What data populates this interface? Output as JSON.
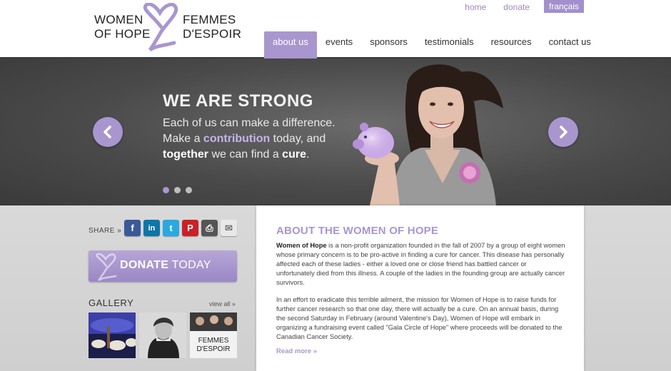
{
  "logo": {
    "line1_en": "WOMEN",
    "line2_en": "OF HOPE",
    "line1_fr": "FEMMES",
    "line2_fr": "D'ESPOIR"
  },
  "top_links": [
    "home",
    "donate"
  ],
  "lang_button": "français",
  "nav": [
    "about us",
    "events",
    "sponsors",
    "testimonials",
    "resources",
    "contact us"
  ],
  "hero": {
    "title": "WE ARE STRONG",
    "line1": "Each of us can make a difference.",
    "line2_pre": "Make a ",
    "line2_hl": "contribution",
    "line2_post": " today, and",
    "line3_b1": "together",
    "line3_mid": " we can find a ",
    "line3_b2": "cure",
    "line3_post": ".",
    "active_slide": 1,
    "slide_count": 3
  },
  "share": {
    "label": "SHARE »",
    "icons": [
      {
        "name": "facebook-icon",
        "glyph": "f",
        "color": "#3b5998"
      },
      {
        "name": "linkedin-icon",
        "glyph": "in",
        "color": "#0e76a8"
      },
      {
        "name": "twitter-icon",
        "glyph": "t",
        "color": "#2aa9e0"
      },
      {
        "name": "pinterest-icon",
        "glyph": "P",
        "color": "#cb2027"
      },
      {
        "name": "print-icon",
        "glyph": "⎙",
        "color": "#555555"
      },
      {
        "name": "email-icon",
        "glyph": "✉",
        "color": "#e8e8e8"
      }
    ]
  },
  "donate": {
    "strong": "DONATE",
    "rest": " TODAY"
  },
  "gallery": {
    "title": "GALLERY",
    "view_all": "view all »",
    "thumb3_text1": "FEMMES",
    "thumb3_text2": "D'ESPOIR"
  },
  "about": {
    "title": "ABOUT THE WOMEN OF HOPE",
    "para1_name": "Women of Hope",
    "para1_rest": " is a non-profit organization founded in the fall of 2007 by a group of eight women whose primary concern is to be pro-active in finding a cure for cancer. This disease has personally affected each of these ladies - either a loved one or close friend has battled cancer or unfortunately died from this illness. A couple of the ladies in the founding group are actually cancer survivors.",
    "para2": "In an effort to eradicate this terrible ailment, the mission for Women of Hope is to raise funds for further cancer research so that one day, there will actually be a cure. On an annual basis, during the second Saturday in February (around Valentine's Day), Women of Hope will embark in organizing a fundraising event called \"Gala Circle of Hope\" where proceeds will be donated to the Canadian Cancer Society.",
    "read_more": "Read more »"
  },
  "colors": {
    "accent": "#a996cf",
    "hero_bg": "#4a4a4a",
    "lower_bg": "#d5d5d5"
  }
}
